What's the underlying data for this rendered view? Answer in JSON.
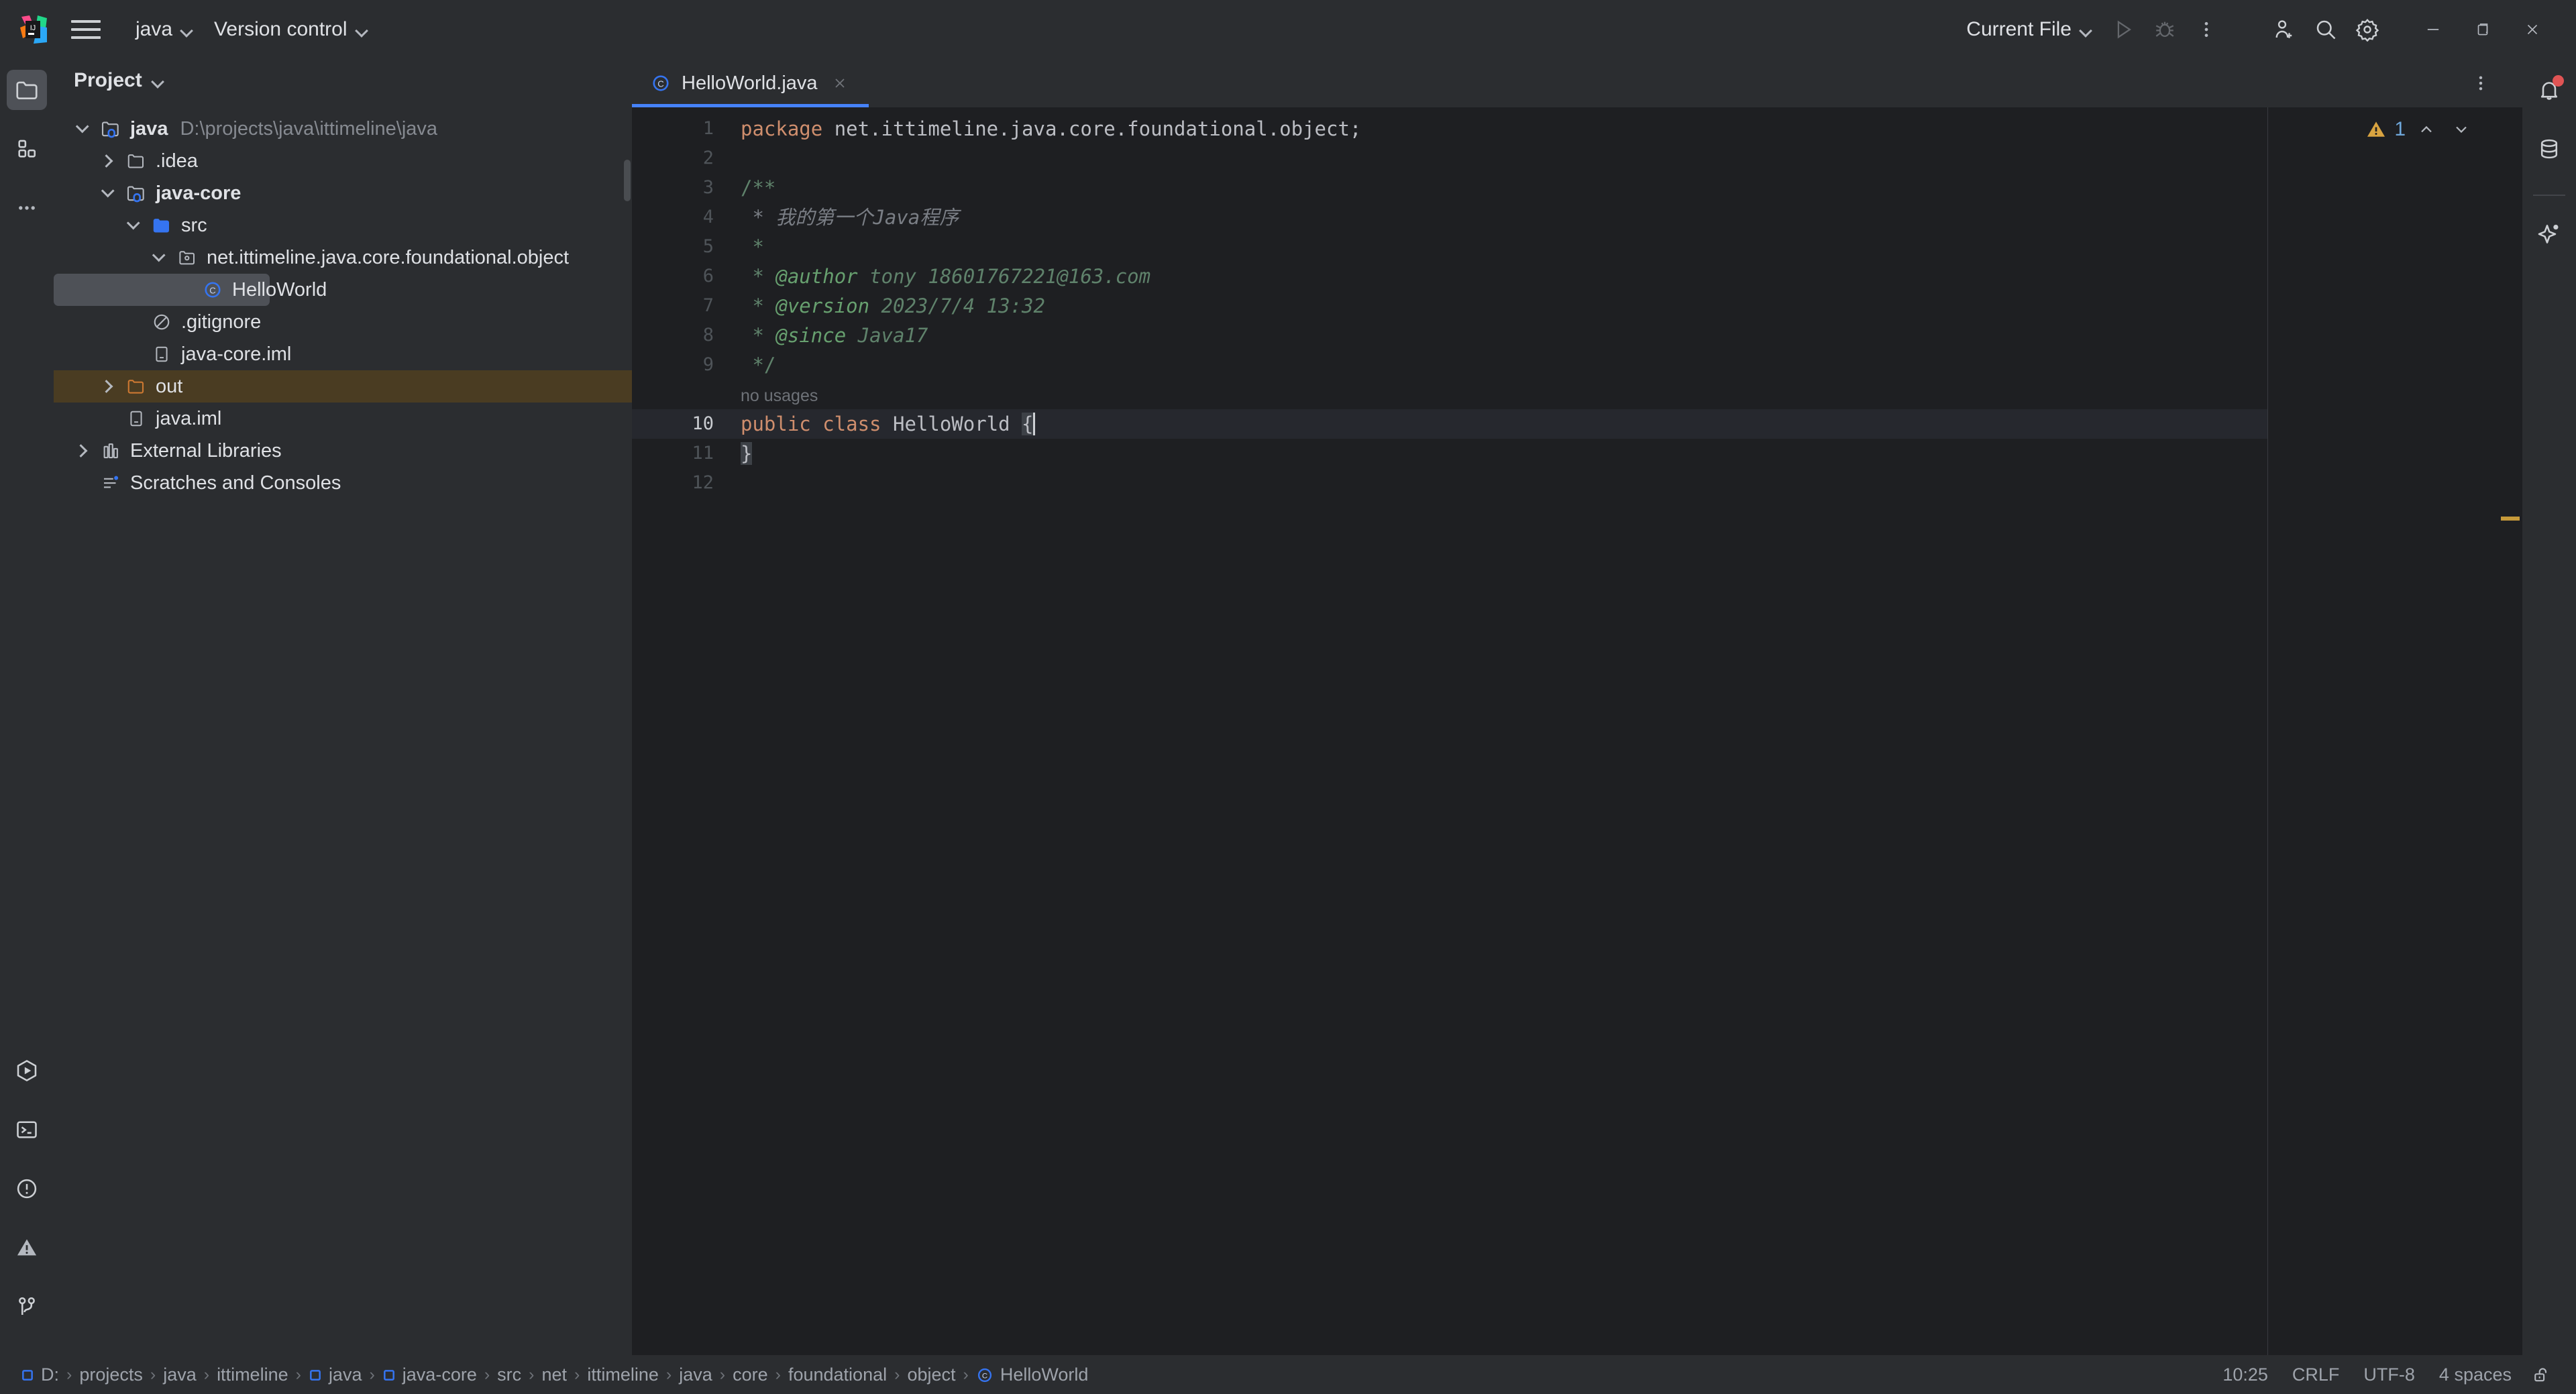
{
  "titlebar": {
    "logo_icon": "intellij-idea-logo",
    "menu_icon": "hamburger-menu-icon",
    "project_name": "java",
    "vcs_label": "Version control",
    "run_config": "Current File",
    "run_icon": "run-icon",
    "debug_icon": "debug-icon",
    "more_icon": "more-vertical-icon",
    "account_icon": "add-account-icon",
    "search_icon": "search-icon",
    "settings_icon": "gear-icon",
    "minimize_icon": "minimize-icon",
    "maximize_icon": "maximize-restore-icon",
    "close_icon": "close-icon"
  },
  "left_rail": {
    "top": [
      {
        "name": "project-tool-window",
        "icon": "folder-icon",
        "active": true
      },
      {
        "name": "structure-tool-window",
        "icon": "blocks-icon",
        "active": false
      },
      {
        "name": "more-tool-windows",
        "icon": "ellipsis-icon",
        "active": false
      }
    ],
    "bottom": [
      {
        "name": "run-tool-window",
        "icon": "run-hex-icon"
      },
      {
        "name": "terminal-tool-window",
        "icon": "terminal-icon"
      },
      {
        "name": "problems-tool-window",
        "icon": "exclamation-circle-icon"
      },
      {
        "name": "warnings-tool-window",
        "icon": "warning-triangle-icon"
      },
      {
        "name": "git-tool-window",
        "icon": "git-branch-icon"
      }
    ]
  },
  "right_rail": {
    "items": [
      {
        "name": "notifications",
        "icon": "bell-icon",
        "badge": true
      },
      {
        "name": "database",
        "icon": "database-icon",
        "badge": false
      },
      {
        "name": "ai-assistant",
        "icon": "sparkle-icon",
        "badge": false
      }
    ]
  },
  "project_panel": {
    "title": "Project",
    "dropdown_icon": "chevron-down-icon",
    "tree": [
      {
        "label": "java",
        "path": "D:\\projects\\java\\ittimeline\\java",
        "depth": 0,
        "twist": "open",
        "icon": "module-folder-icon",
        "bold": true,
        "state": "normal"
      },
      {
        "label": ".idea",
        "path": "",
        "depth": 1,
        "twist": "closed",
        "icon": "folder-icon",
        "bold": false,
        "state": "normal"
      },
      {
        "label": "java-core",
        "path": "",
        "depth": 1,
        "twist": "open",
        "icon": "module-folder-icon",
        "bold": true,
        "state": "normal"
      },
      {
        "label": "src",
        "path": "",
        "depth": 2,
        "twist": "open",
        "icon": "source-folder-icon",
        "bold": false,
        "state": "normal"
      },
      {
        "label": "net.ittimeline.java.core.foundational.object",
        "path": "",
        "depth": 3,
        "twist": "open",
        "icon": "package-icon",
        "bold": false,
        "state": "normal"
      },
      {
        "label": "HelloWorld",
        "path": "",
        "depth": 4,
        "twist": "none",
        "icon": "java-class-icon",
        "bold": false,
        "state": "selected"
      },
      {
        "label": ".gitignore",
        "path": "",
        "depth": 2,
        "twist": "none",
        "icon": "gitignore-icon",
        "bold": false,
        "state": "normal"
      },
      {
        "label": "java-core.iml",
        "path": "",
        "depth": 2,
        "twist": "none",
        "icon": "iml-file-icon",
        "bold": false,
        "state": "normal"
      },
      {
        "label": "out",
        "path": "",
        "depth": 1,
        "twist": "closed",
        "icon": "excluded-folder-icon",
        "bold": false,
        "state": "highlight"
      },
      {
        "label": "java.iml",
        "path": "",
        "depth": 1,
        "twist": "none",
        "icon": "iml-file-icon",
        "bold": false,
        "state": "normal"
      },
      {
        "label": "External Libraries",
        "path": "",
        "depth": 0,
        "twist": "closed",
        "icon": "libraries-icon",
        "bold": false,
        "state": "normal"
      },
      {
        "label": "Scratches and Consoles",
        "path": "",
        "depth": 0,
        "twist": "none",
        "icon": "scratches-icon",
        "bold": false,
        "state": "normal"
      }
    ]
  },
  "editor": {
    "tabs": [
      {
        "label": "HelloWorld.java",
        "icon": "java-class-icon",
        "close_icon": "close-icon",
        "active": true
      }
    ],
    "tab_more_icon": "more-vertical-icon",
    "inspection": {
      "warning_icon": "warning-triangle-icon",
      "count": "1",
      "prev_icon": "chevron-up-icon",
      "next_icon": "chevron-down-icon"
    },
    "gutter_numbers": [
      "1",
      "2",
      "3",
      "4",
      "5",
      "6",
      "7",
      "8",
      "9",
      "",
      "10",
      "11",
      "12"
    ],
    "current_line": "10",
    "lines": [
      {
        "n": "1",
        "tokens": [
          {
            "t": "package ",
            "c": "kw"
          },
          {
            "t": "net.ittimeline.java.core.foundational.object;",
            "c": "plain"
          }
        ]
      },
      {
        "n": "2",
        "tokens": []
      },
      {
        "n": "3",
        "tokens": [
          {
            "t": "/**",
            "c": "doc"
          }
        ]
      },
      {
        "n": "4",
        "tokens": [
          {
            "t": " * 我的第一个Java程序",
            "c": "doc-italic"
          }
        ]
      },
      {
        "n": "5",
        "tokens": [
          {
            "t": " *",
            "c": "doc"
          }
        ]
      },
      {
        "n": "6",
        "tokens": [
          {
            "t": " * ",
            "c": "doc"
          },
          {
            "t": "@author",
            "c": "doctag"
          },
          {
            "t": " tony 18601767221@163.com",
            "c": "doc"
          }
        ]
      },
      {
        "n": "7",
        "tokens": [
          {
            "t": " * ",
            "c": "doc"
          },
          {
            "t": "@version",
            "c": "doctag"
          },
          {
            "t": " 2023/7/4 13:32",
            "c": "doc"
          }
        ]
      },
      {
        "n": "8",
        "tokens": [
          {
            "t": " * ",
            "c": "doc"
          },
          {
            "t": "@since",
            "c": "doctag"
          },
          {
            "t": " Java17",
            "c": "doc"
          }
        ]
      },
      {
        "n": "9",
        "tokens": [
          {
            "t": " */",
            "c": "doc"
          }
        ]
      },
      {
        "n": "",
        "tokens": [
          {
            "t": "no usages",
            "c": "hint"
          }
        ]
      },
      {
        "n": "10",
        "tokens": [
          {
            "t": "public class ",
            "c": "kw"
          },
          {
            "t": "HelloWorld ",
            "c": "cls"
          },
          {
            "t": "{",
            "c": "brace"
          }
        ]
      },
      {
        "n": "11",
        "tokens": [
          {
            "t": "}",
            "c": "brace"
          }
        ]
      },
      {
        "n": "12",
        "tokens": []
      }
    ],
    "inlay_hint": "no usages"
  },
  "statusbar": {
    "breadcrumbs": [
      {
        "label": "D:",
        "icon": "drive-icon"
      },
      {
        "label": "projects",
        "icon": ""
      },
      {
        "label": "java",
        "icon": ""
      },
      {
        "label": "ittimeline",
        "icon": ""
      },
      {
        "label": "java",
        "icon": "drive-icon"
      },
      {
        "label": "java-core",
        "icon": "drive-icon"
      },
      {
        "label": "src",
        "icon": ""
      },
      {
        "label": "net",
        "icon": ""
      },
      {
        "label": "ittimeline",
        "icon": ""
      },
      {
        "label": "java",
        "icon": ""
      },
      {
        "label": "core",
        "icon": ""
      },
      {
        "label": "foundational",
        "icon": ""
      },
      {
        "label": "object",
        "icon": ""
      },
      {
        "label": "HelloWorld",
        "icon": "java-class-icon"
      }
    ],
    "separator": "›",
    "caret_position": "10:25",
    "line_separator": "CRLF",
    "encoding": "UTF-8",
    "indent": "4 spaces",
    "lock_icon": "unlocked-icon"
  },
  "colors": {
    "bg_chrome": "#2b2d30",
    "bg_editor": "#1e1f22",
    "selection": "#4e5157",
    "excluded_highlight": "#4a3c22",
    "accent_blue": "#4682fa",
    "keyword": "#cf8e6d",
    "doc_comment": "#5f826b",
    "doc_tag": "#67a06f",
    "text": "#bcbec4",
    "muted": "#868a91",
    "warning": "#d9a441",
    "notification_badge": "#e05454"
  }
}
